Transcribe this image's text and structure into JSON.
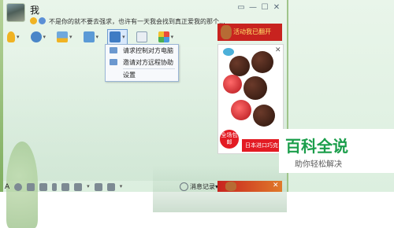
{
  "header": {
    "nickname": "我",
    "signature": "不是你的就不要去强求，也许有一天我会找到真正爱我的那个...",
    "window_controls": [
      "▭",
      "—",
      "☐",
      "✕"
    ]
  },
  "toolbar": {
    "items": [
      "microphone",
      "camera",
      "screen-share",
      "folder",
      "remote-assist",
      "app-add",
      "apps"
    ]
  },
  "remote_menu": {
    "items": [
      "请求控制对方电脑",
      "邀请对方远程协助"
    ],
    "settings": "设置"
  },
  "bottom_bar": {
    "history_label": "消息记录",
    "history_caret": "▾"
  },
  "ads": {
    "top_banner": "活动我已翻开",
    "promo_badge": "全场包邮",
    "import_label": "日本进口巧克",
    "close": "✕"
  },
  "watermark": {
    "logo": "百科全说",
    "subtitle": "助你轻松解决"
  },
  "colors": {
    "accent": "#6b98cf",
    "ad_red": "#c8231f",
    "watermark_green": "#1b9e4b",
    "chat_bg": "#dcefdf"
  }
}
